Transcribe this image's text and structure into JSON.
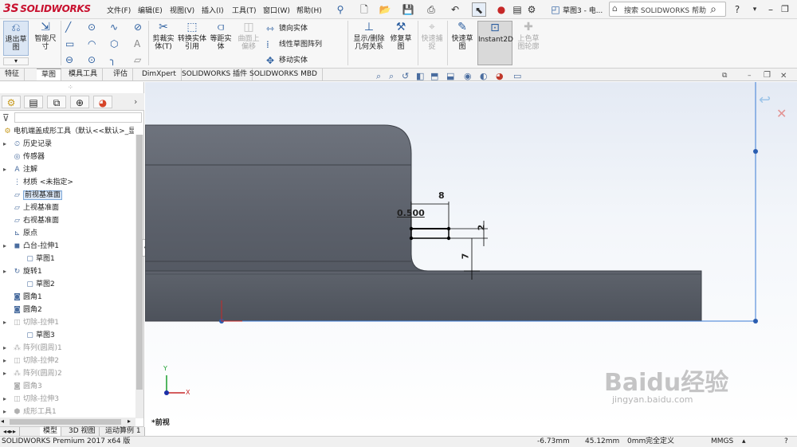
{
  "app": {
    "logo_text": "SOLIDWORKS",
    "logo_mark": "3S"
  },
  "menu": [
    "文件(F)",
    "编辑(E)",
    "视图(V)",
    "插入(I)",
    "工具(T)",
    "窗口(W)",
    "帮助(H)"
  ],
  "doc_title": "草图3 - 电...",
  "search": {
    "placeholder": "搜索 SOLIDWORKS 帮助"
  },
  "ribbon": {
    "exit_sketch": "退出草图",
    "smart_dim": "智能尺寸",
    "trim": "剪裁实体(T)",
    "convert": "转换实体引用",
    "offset": "等距实体",
    "surface_offset": "曲面上偏移",
    "mirror": "镜向实体",
    "linear_pattern": "线性草图阵列",
    "move": "移动实体",
    "show_delete": "显示/删除几何关系",
    "repair": "修复草图",
    "quick_snap": "快速捕捉",
    "rapid_sketch": "快速草图",
    "instant2d": "Instant2D",
    "shaded_contours": "上色草图轮廓"
  },
  "tabs": [
    "特征",
    "草图",
    "模具工具",
    "评估",
    "DimXpert",
    "SOLIDWORKS 插件",
    "SOLIDWORKS MBD"
  ],
  "tree": {
    "root": "电机端盖成形工具（默认<<默认>_显示",
    "items": [
      {
        "label": "历史记录",
        "icon": "history-icon"
      },
      {
        "label": "传感器",
        "icon": "sensor-icon"
      },
      {
        "label": "注解",
        "icon": "annotation-icon"
      },
      {
        "label": "材质 <未指定>",
        "icon": "material-icon"
      },
      {
        "label": "前视基准面",
        "icon": "plane-icon"
      },
      {
        "label": "上视基准面",
        "icon": "plane-icon"
      },
      {
        "label": "右视基准面",
        "icon": "plane-icon"
      },
      {
        "label": "原点",
        "icon": "origin-icon"
      },
      {
        "label": "凸台-拉伸1",
        "icon": "extrude-icon"
      },
      {
        "label": "草图1",
        "icon": "sketch-icon"
      },
      {
        "label": "旋转1",
        "icon": "revolve-icon"
      },
      {
        "label": "草图2",
        "icon": "sketch-icon"
      },
      {
        "label": "圆角1",
        "icon": "fillet-icon"
      },
      {
        "label": "圆角2",
        "icon": "fillet-icon"
      },
      {
        "label": "切除-拉伸1",
        "icon": "cut-icon"
      },
      {
        "label": "草图3",
        "icon": "sketch-icon"
      },
      {
        "label": "阵列(圆周)1",
        "icon": "pattern-icon"
      },
      {
        "label": "切除-拉伸2",
        "icon": "cut-icon"
      },
      {
        "label": "阵列(圆周)2",
        "icon": "pattern-icon"
      },
      {
        "label": "圆角3",
        "icon": "fillet-icon"
      },
      {
        "label": "切除-拉伸3",
        "icon": "cut-icon"
      },
      {
        "label": "成形工具1",
        "icon": "form-tool-icon"
      }
    ]
  },
  "bottom_tabs": [
    "模型",
    "3D 视图",
    "运动算例 1"
  ],
  "dimensions": {
    "width": "8",
    "offset": "0.500",
    "height": "2",
    "depth": "7"
  },
  "view_label": "*前视",
  "status": {
    "product": "SOLIDWORKS Premium 2017 x64 版",
    "x": "-6.73mm",
    "y": "45.12mm",
    "z": "0mm",
    "state": "完全定义",
    "units": "MMGS"
  },
  "watermark": {
    "brand": "Baidu经验",
    "url": "jingyan.baidu.com"
  },
  "colors": {
    "accent": "#2a5d9f",
    "model": "#5a5f69",
    "logo": "#c8102e"
  }
}
